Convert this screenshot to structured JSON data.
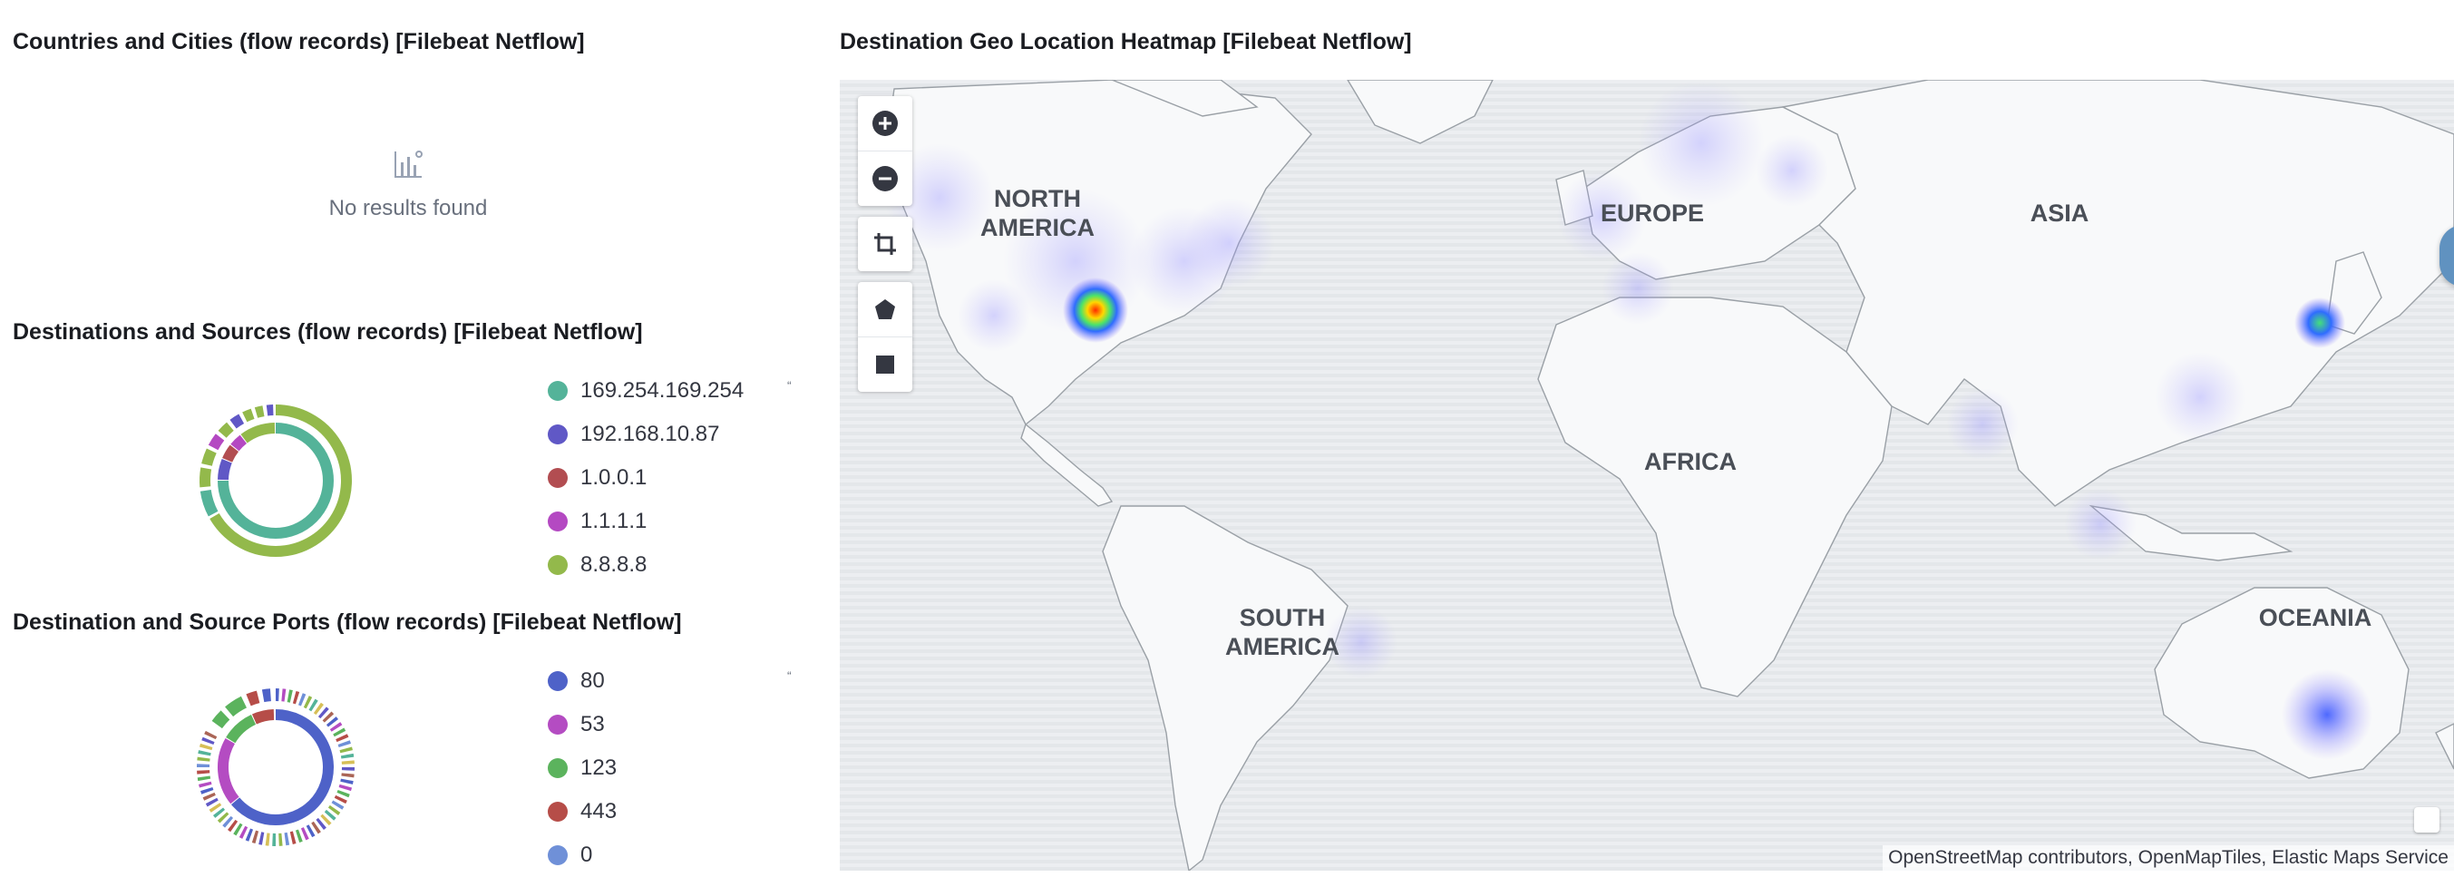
{
  "panels": {
    "countries": {
      "title": "Countries and Cities (flow records) [Filebeat Netflow]",
      "empty_icon": "chart-empty-icon",
      "empty_text": "No results found"
    },
    "destinations": {
      "title": "Destinations and Sources (flow records) [Filebeat Netflow]",
      "legend": [
        {
          "label": "169.254.169.254",
          "color": "#54b399"
        },
        {
          "label": "192.168.10.87",
          "color": "#6058c6"
        },
        {
          "label": "1.0.0.1",
          "color": "#b24d51"
        },
        {
          "label": "1.1.1.1",
          "color": "#b449c2"
        },
        {
          "label": "8.8.8.8",
          "color": "#93b94b"
        }
      ]
    },
    "ports": {
      "title": "Destination and Source Ports (flow records) [Filebeat Netflow]",
      "legend": [
        {
          "label": "80",
          "color": "#4e62c8"
        },
        {
          "label": "53",
          "color": "#b44cc2"
        },
        {
          "label": "123",
          "color": "#5bb35d"
        },
        {
          "label": "443",
          "color": "#b64d48"
        },
        {
          "label": "0",
          "color": "#6f90d8"
        }
      ]
    },
    "map": {
      "title": "Destination Geo Location Heatmap [Filebeat Netflow]",
      "regions": [
        "NORTH AMERICA",
        "EUROPE",
        "ASIA",
        "AFRICA",
        "SOUTH AMERICA",
        "OCEANIA"
      ],
      "tools": [
        "zoom-in-icon",
        "zoom-out-icon",
        "crop-icon",
        "polygon-icon",
        "rectangle-icon"
      ],
      "attribution": "OpenStreetMap contributors, OpenMapTiles, Elastic Maps Service"
    }
  }
}
